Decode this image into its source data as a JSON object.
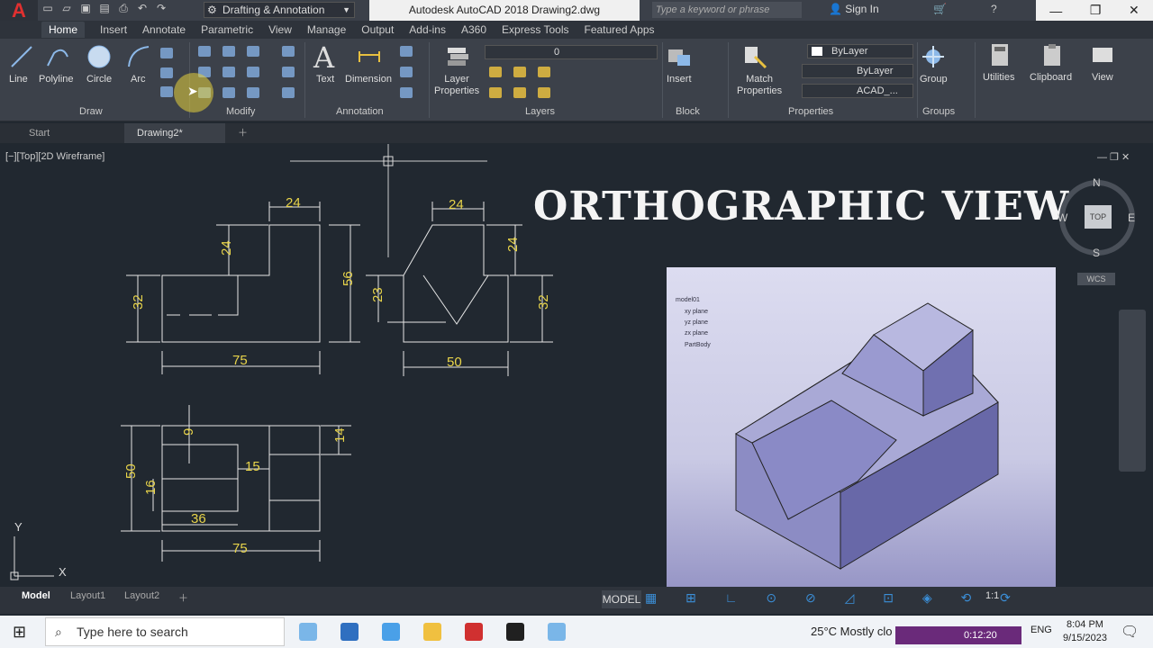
{
  "titlebar": {
    "app_logo": "A",
    "workspace": "Drafting & Annotation",
    "title": "Autodesk AutoCAD 2018   Drawing2.dwg",
    "search_placeholder": "Type a keyword or phrase",
    "signin": "Sign In"
  },
  "ribbon": {
    "tabs": [
      "Home",
      "Insert",
      "Annotate",
      "Parametric",
      "View",
      "Manage",
      "Output",
      "Add-ins",
      "A360",
      "Express Tools",
      "Featured Apps"
    ],
    "draw": {
      "line": "Line",
      "polyline": "Polyline",
      "circle": "Circle",
      "arc": "Arc",
      "title": "Draw"
    },
    "modify_title": "Modify",
    "annotation": {
      "text": "Text",
      "dimension": "Dimension",
      "title": "Annotation"
    },
    "layers": {
      "layer_props": "Layer\nProperties",
      "title": "Layers",
      "current": "0"
    },
    "block": {
      "insert": "Insert",
      "title": "Block"
    },
    "properties": {
      "match": "Match\nProperties",
      "color": "ByLayer",
      "linetype": "ByLayer",
      "lineweight": "ACAD_...",
      "title": "Properties"
    },
    "groups": {
      "group": "Group",
      "title": "Groups"
    },
    "utilities": "Utilities",
    "clipboard": "Clipboard",
    "view": "View"
  },
  "file_tabs": {
    "start": "Start",
    "drawing": "Drawing2*"
  },
  "canvas": {
    "viewport_label": "[−][Top][2D Wireframe]",
    "overlay_title": "ORTHOGRAPHIC VIEW",
    "viewcube": {
      "n": "N",
      "s": "S",
      "e": "E",
      "w": "W",
      "top": "TOP",
      "wcs": "WCS"
    },
    "ucs": {
      "x": "X",
      "y": "Y"
    },
    "dims": {
      "front_24_top": "24",
      "front_24_left": "24",
      "front_32": "32",
      "front_75": "75",
      "front_56": "56",
      "side_24_top": "24",
      "side_24_right": "24",
      "side_23": "23",
      "side_32": "32",
      "side_50": "50",
      "plan_9": "9",
      "plan_15": "15",
      "plan_14": "14",
      "plan_50": "50",
      "plan_16": "16",
      "plan_36": "36",
      "plan_75": "75"
    },
    "tree": [
      "model01",
      "xy plane",
      "yz plane",
      "zx plane",
      "PartBody"
    ]
  },
  "layout_tabs": [
    "Model",
    "Layout1",
    "Layout2"
  ],
  "status": {
    "model": "MODEL",
    "scale": "1:1"
  },
  "taskbar": {
    "search": "Type here to search",
    "weather": "25°C  Mostly clo",
    "recorder": "0:12:20",
    "lang": "ENG",
    "time": "8:04 PM",
    "date": "9/15/2023"
  },
  "colors": {
    "canvas": "#212830",
    "dim": "#e8d44a",
    "geometry": "#e6e6e6",
    "accent": "#3b8fd8"
  }
}
